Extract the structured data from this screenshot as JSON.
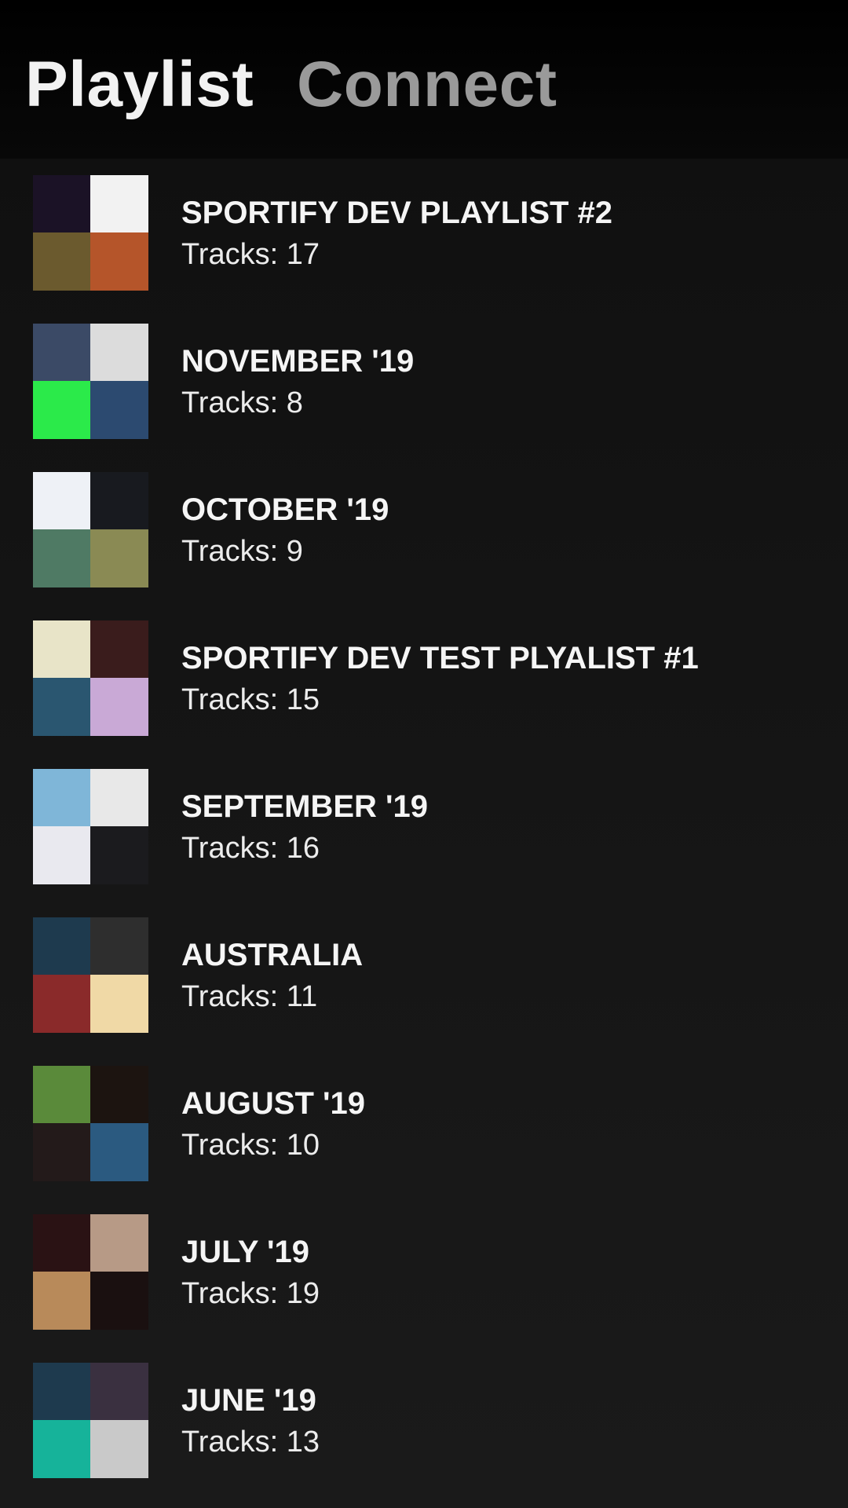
{
  "tabs": {
    "playlist_label": "Playlist",
    "connect_label": "Connect"
  },
  "playlists": [
    {
      "title": "SPORTIFY DEV PLAYLIST #2",
      "tracks": "Tracks: 17",
      "cover_colors": [
        "#1b1226",
        "#f2f2f2",
        "#6b5a2e",
        "#b5552a"
      ]
    },
    {
      "title": "NOVEMBER '19",
      "tracks": "Tracks: 8",
      "cover_colors": [
        "#3b4a66",
        "#dcdcdc",
        "#2bea4a",
        "#2c4a70"
      ]
    },
    {
      "title": "OCTOBER '19",
      "tracks": "Tracks: 9",
      "cover_colors": [
        "#eef1f6",
        "#181a1f",
        "#4f7a64",
        "#8a8a54"
      ]
    },
    {
      "title": "SPORTIFY DEV TEST PLYALIST #1",
      "tracks": "Tracks: 15",
      "cover_colors": [
        "#e8e4c8",
        "#3a1c1c",
        "#2a5670",
        "#c9a9d6"
      ]
    },
    {
      "title": "SEPTEMBER '19",
      "tracks": "Tracks: 16",
      "cover_colors": [
        "#7fb6d8",
        "#e8e8e8",
        "#e9e9ef",
        "#1b1b1e"
      ]
    },
    {
      "title": "AUSTRALIA",
      "tracks": "Tracks: 11",
      "cover_colors": [
        "#1e3a4e",
        "#2e2e2e",
        "#8a2a2a",
        "#f0d9a6"
      ]
    },
    {
      "title": "AUGUST '19",
      "tracks": "Tracks: 10",
      "cover_colors": [
        "#5a8a3a",
        "#1c1410",
        "#231a1a",
        "#2b5a80"
      ]
    },
    {
      "title": "JULY '19",
      "tracks": "Tracks: 19",
      "cover_colors": [
        "#2a1214",
        "#b79a86",
        "#b88a5a",
        "#1a1010"
      ]
    },
    {
      "title": "JUNE '19",
      "tracks": "Tracks: 13",
      "cover_colors": [
        "#1e3a4e",
        "#3a3040",
        "#16b39a",
        "#c9c9c9"
      ]
    }
  ]
}
